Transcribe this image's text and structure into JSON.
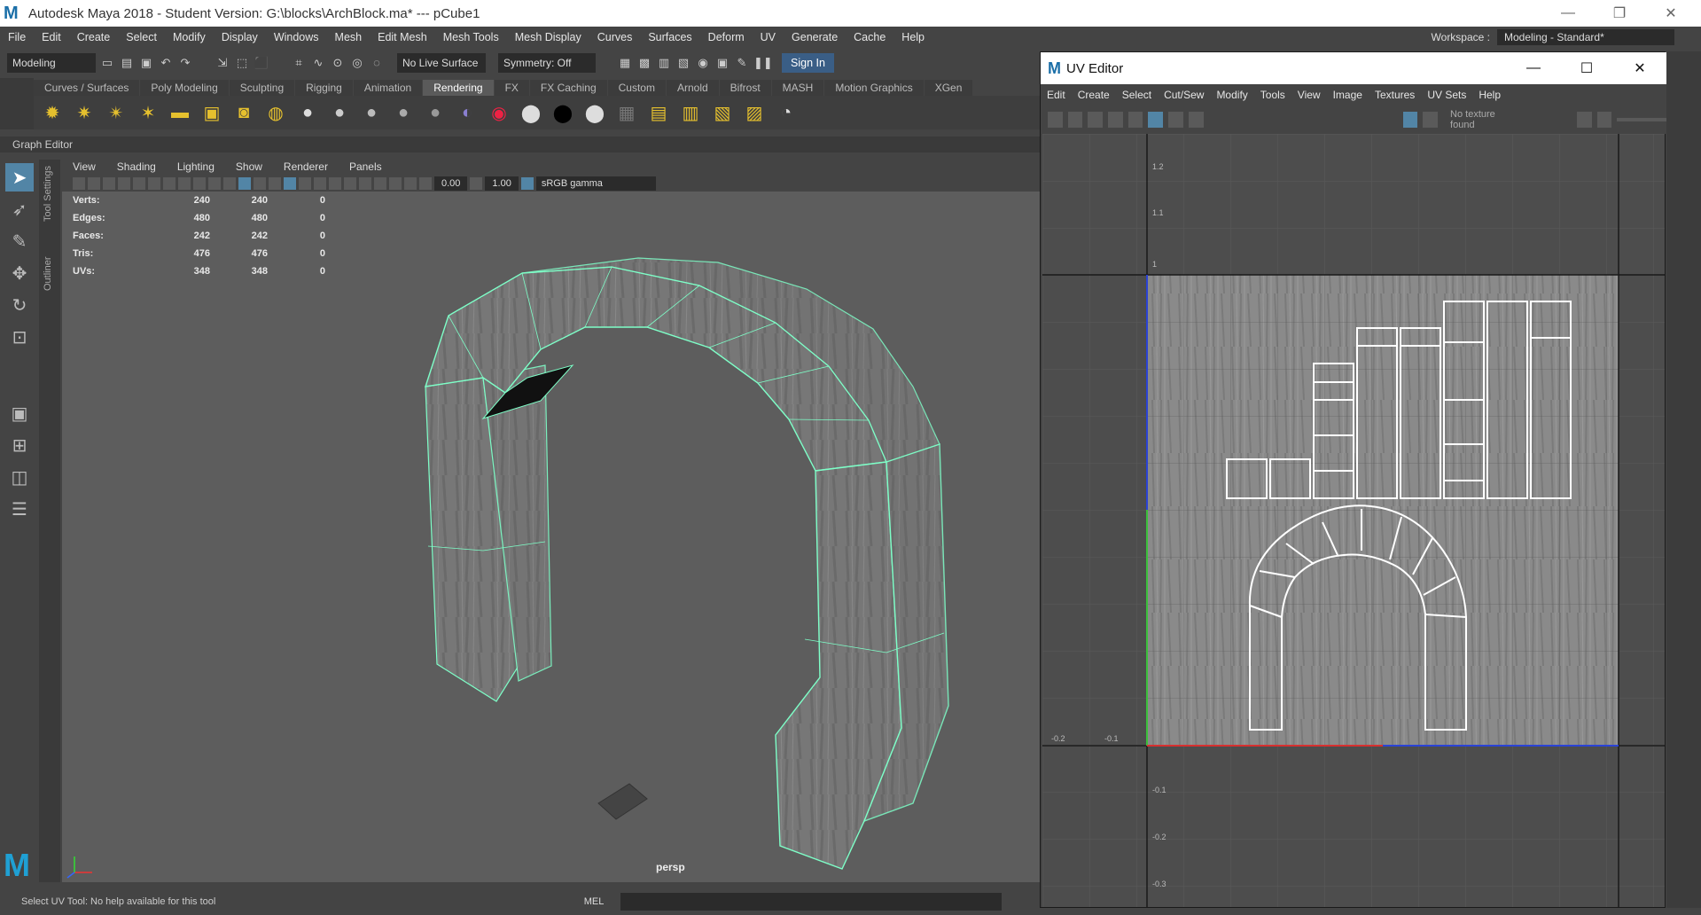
{
  "window": {
    "title": "Autodesk Maya 2018 - Student Version: G:\\blocks\\ArchBlock.ma*   ---   pCube1",
    "logo_letter": "M",
    "controls": [
      "—",
      "❐",
      "✕"
    ]
  },
  "menubar": {
    "items": [
      "File",
      "Edit",
      "Create",
      "Select",
      "Modify",
      "Display",
      "Windows",
      "Mesh",
      "Edit Mesh",
      "Mesh Tools",
      "Mesh Display",
      "Curves",
      "Surfaces",
      "Deform",
      "UV",
      "Generate",
      "Cache",
      "Help"
    ],
    "workspace_label": "Workspace :",
    "workspace_value": "Modeling - Standard*"
  },
  "statusline": {
    "mode": "Modeling",
    "live_surface": "No Live Surface",
    "symmetry": "Symmetry: Off",
    "sign_in": "Sign In"
  },
  "shelf": {
    "tabs": [
      "Curves / Surfaces",
      "Poly Modeling",
      "Sculpting",
      "Rigging",
      "Animation",
      "Rendering",
      "FX",
      "FX Caching",
      "Custom",
      "Arnold",
      "Bifrost",
      "MASH",
      "Motion Graphics",
      "XGen"
    ],
    "active_tab": "Rendering"
  },
  "graph_editor_label": "Graph Editor",
  "side_tabs": [
    "Tool Settings",
    "Outliner"
  ],
  "panel": {
    "menu": [
      "View",
      "Shading",
      "Lighting",
      "Show",
      "Renderer",
      "Panels"
    ],
    "exposure": "0.00",
    "gamma": "1.00",
    "color_space": "sRGB gamma",
    "camera": "persp"
  },
  "hud": [
    {
      "label": "Verts:",
      "a": "240",
      "b": "240",
      "c": "0"
    },
    {
      "label": "Edges:",
      "a": "480",
      "b": "480",
      "c": "0"
    },
    {
      "label": "Faces:",
      "a": "242",
      "b": "242",
      "c": "0"
    },
    {
      "label": "Tris:",
      "a": "476",
      "b": "476",
      "c": "0"
    },
    {
      "label": "UVs:",
      "a": "348",
      "b": "348",
      "c": "0"
    }
  ],
  "helpline": {
    "text": "Select UV Tool: No help available for this tool",
    "mel": "MEL"
  },
  "uv_editor": {
    "title": "UV Editor",
    "menu": [
      "Edit",
      "Create",
      "Select",
      "Cut/Sew",
      "Modify",
      "Tools",
      "View",
      "Image",
      "Textures",
      "UV Sets",
      "Help"
    ],
    "no_texture": "No texture found",
    "axis_labels": [
      "1.2",
      "1.1",
      "1",
      "-0.2",
      "-0.1",
      "-0.1",
      "-0.2",
      "-0.3"
    ]
  },
  "colors": {
    "ui_bg": "#444444",
    "viewport_bg": "#5d5d5d",
    "selection": "#7effc8",
    "sign_in": "#3a5e86",
    "brand": "#1fa0d4"
  }
}
